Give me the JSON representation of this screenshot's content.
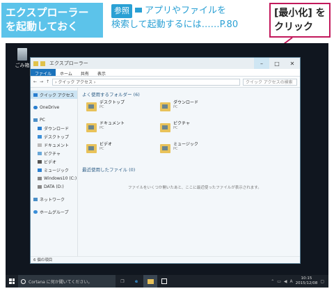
{
  "annotations": {
    "step_line1": "エクスプローラー",
    "step_line2": "を起動しておく",
    "ref_badge": "参照",
    "ref_line1": "アプリやファイルを",
    "ref_line2": "検索して起動するには……P.80",
    "click_line1": "[最小化] を",
    "click_line2": "クリック",
    "accent_color": "#5cc3ea",
    "callout_border_color": "#c2185b"
  },
  "desktop": {
    "recycle_bin_label": "ごみ箱"
  },
  "explorer": {
    "title": "エクスプローラー",
    "window_buttons": {
      "minimize": "–",
      "maximize": "□",
      "close": "✕"
    },
    "ribbon_tabs": [
      "ファイル",
      "ホーム",
      "共有",
      "表示"
    ],
    "address": "› クイック アクセス ›",
    "search_placeholder": "クイック アクセスの検索",
    "nav": {
      "quick_access": "クイック アクセス",
      "onedrive": "OneDrive",
      "pc": "PC",
      "download": "ダウンロード",
      "desktop": "デスクトップ",
      "documents": "ドキュメント",
      "pictures": "ピクチャ",
      "videos": "ビデオ",
      "music": "ミュージック",
      "windows10": "Windows10 (C:)",
      "data": "DATA (D:)",
      "network": "ネットワーク",
      "homegroup": "ホームグループ"
    },
    "frequent_title": "よく使用するフォルダー (6)",
    "folders": [
      {
        "name": "デスクトップ",
        "sub": "PC"
      },
      {
        "name": "ダウンロード",
        "sub": "PC"
      },
      {
        "name": "ドキュメント",
        "sub": "PC"
      },
      {
        "name": "ピクチャ",
        "sub": "PC"
      },
      {
        "name": "ビデオ",
        "sub": "PC"
      },
      {
        "name": "ミュージック",
        "sub": "PC"
      }
    ],
    "recent_title": "最近使用したファイル (0)",
    "recent_empty": "ファイルをいくつか開いたあと、ここに最近使ったファイルが表示されます。",
    "status": "6 個の項目"
  },
  "taskbar": {
    "cortana_placeholder": "Cortana に何か聞いてください。",
    "ime": "A",
    "clock_time": "10:15",
    "clock_date": "2015/12/08"
  }
}
